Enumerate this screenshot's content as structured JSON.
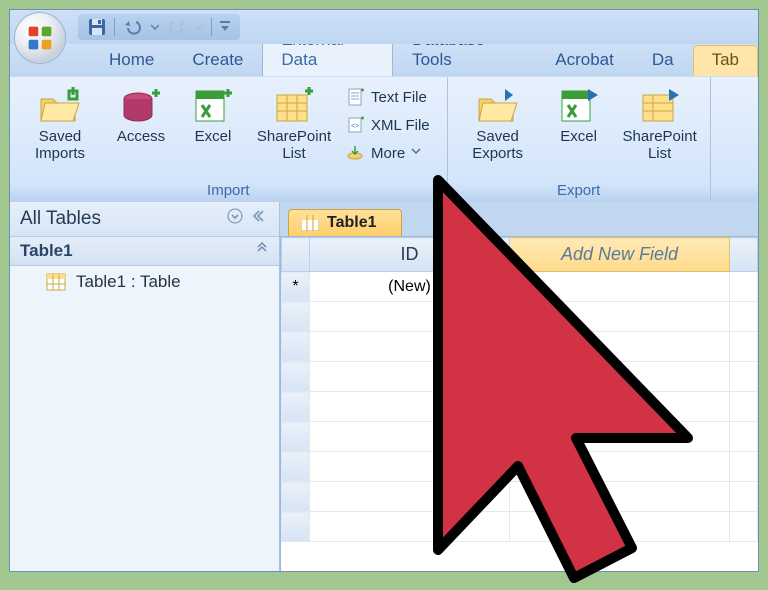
{
  "tabs": {
    "home": "Home",
    "create": "Create",
    "external": "External Data",
    "dbtools": "Database Tools",
    "acrobat": "Acrobat",
    "da": "Da",
    "tab_right": "Tab"
  },
  "ribbon": {
    "import_group": "Import",
    "export_group": "Export",
    "saved_imports": "Saved Imports",
    "access": "Access",
    "excel": "Excel",
    "sharepoint_list": "SharePoint List",
    "text_file": "Text File",
    "xml_file": "XML File",
    "more": "More",
    "saved_exports": "Saved Exports",
    "excel_export": "Excel",
    "sharepoint_list_export": "SharePoint List"
  },
  "nav": {
    "header": "All Tables",
    "group1": "Table1",
    "item1": "Table1 : Table"
  },
  "doc": {
    "tab": "Table1",
    "col_id": "ID",
    "col_add": "Add New Field",
    "new_row": "(New)",
    "star": "*"
  }
}
